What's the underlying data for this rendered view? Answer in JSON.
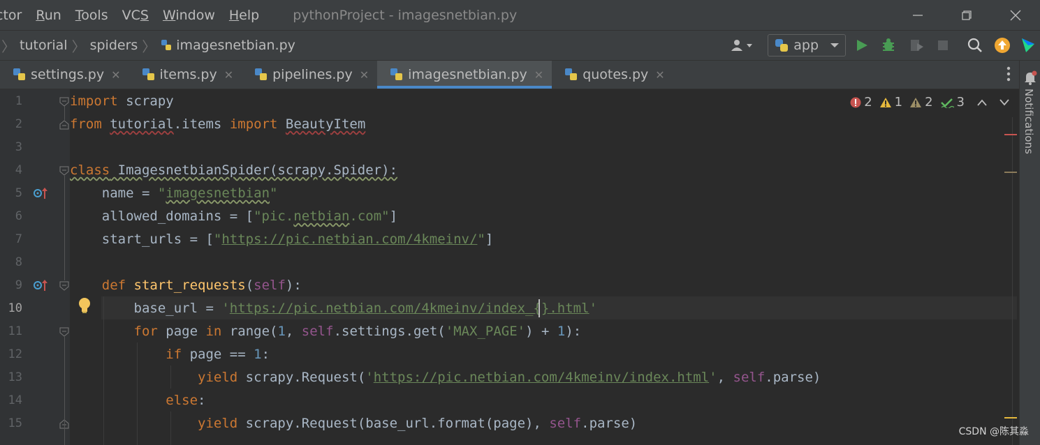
{
  "menubar": {
    "items": [
      {
        "label": "ctor",
        "mnemonic": ""
      },
      {
        "label": "Run",
        "mnemonic": "R"
      },
      {
        "label": "Tools",
        "mnemonic": "T"
      },
      {
        "label": "VCS",
        "mnemonic": "S"
      },
      {
        "label": "Window",
        "mnemonic": "W"
      },
      {
        "label": "Help",
        "mnemonic": "H"
      }
    ],
    "title": "pythonProject - imagesnetbian.py"
  },
  "breadcrumb": {
    "items": [
      "tutorial",
      "spiders",
      "imagesnetbian.py"
    ]
  },
  "toolbar": {
    "run_config": "app"
  },
  "tabs": [
    {
      "label": "settings.py",
      "active": false
    },
    {
      "label": "items.py",
      "active": false
    },
    {
      "label": "pipelines.py",
      "active": false
    },
    {
      "label": "imagesnetbian.py",
      "active": true
    },
    {
      "label": "quotes.py",
      "active": false
    }
  ],
  "inspections": {
    "errors": "2",
    "warnings": "1",
    "weak_warnings": "2",
    "typos": "3"
  },
  "right_panel": {
    "notifications_label": "Notifications"
  },
  "editor": {
    "line_numbers": [
      "1",
      "2",
      "3",
      "4",
      "5",
      "6",
      "7",
      "8",
      "9",
      "10",
      "11",
      "12",
      "13",
      "14",
      "15"
    ],
    "current_line": "10"
  },
  "watermark": "CSDN @陈其淼",
  "colors": {
    "background": "#2b2b2b",
    "keyword": "#cc7832",
    "string": "#6a8759",
    "number": "#6897bb",
    "self": "#94558d",
    "function": "#ffc66d",
    "accent": "#4a88c7",
    "run_green": "#499c54",
    "error_red": "#c75450",
    "warning_yellow": "#e5b83c"
  }
}
